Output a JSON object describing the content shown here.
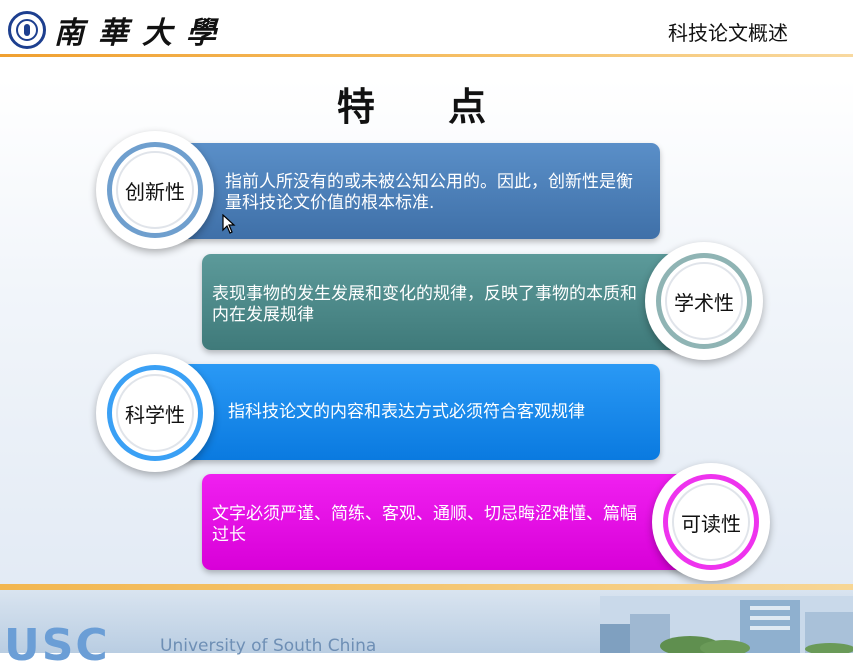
{
  "header": {
    "school_name": "南華大學",
    "course_title": "科技论文概述"
  },
  "title": "特 点",
  "features": [
    {
      "name": "创新性",
      "description": "指前人所没有的或未被公知公用的。因此，创新性是衡量科技论文价值的根本标准.",
      "color": "#4a7eb8",
      "ring_color": "#6f9fce"
    },
    {
      "name": "学术性",
      "description": "表现事物的发生发展和变化的规律，反映了事物的本质和内在发展规律",
      "color": "#4d8a8a",
      "ring_color": "#8fb4b4"
    },
    {
      "name": "科学性",
      "description": "指科技论文的内容和表达方式必须符合客观规律",
      "color": "#1a8cf0",
      "ring_color": "#3aa0f5"
    },
    {
      "name": "可读性",
      "description": "文字必须严谨、简练、客观、通顺、切忌晦涩难懂、篇幅过长",
      "color": "#e800e8",
      "ring_color": "#ee33ee"
    }
  ],
  "footer": {
    "logo_text": "USC",
    "university": "University of South China"
  }
}
